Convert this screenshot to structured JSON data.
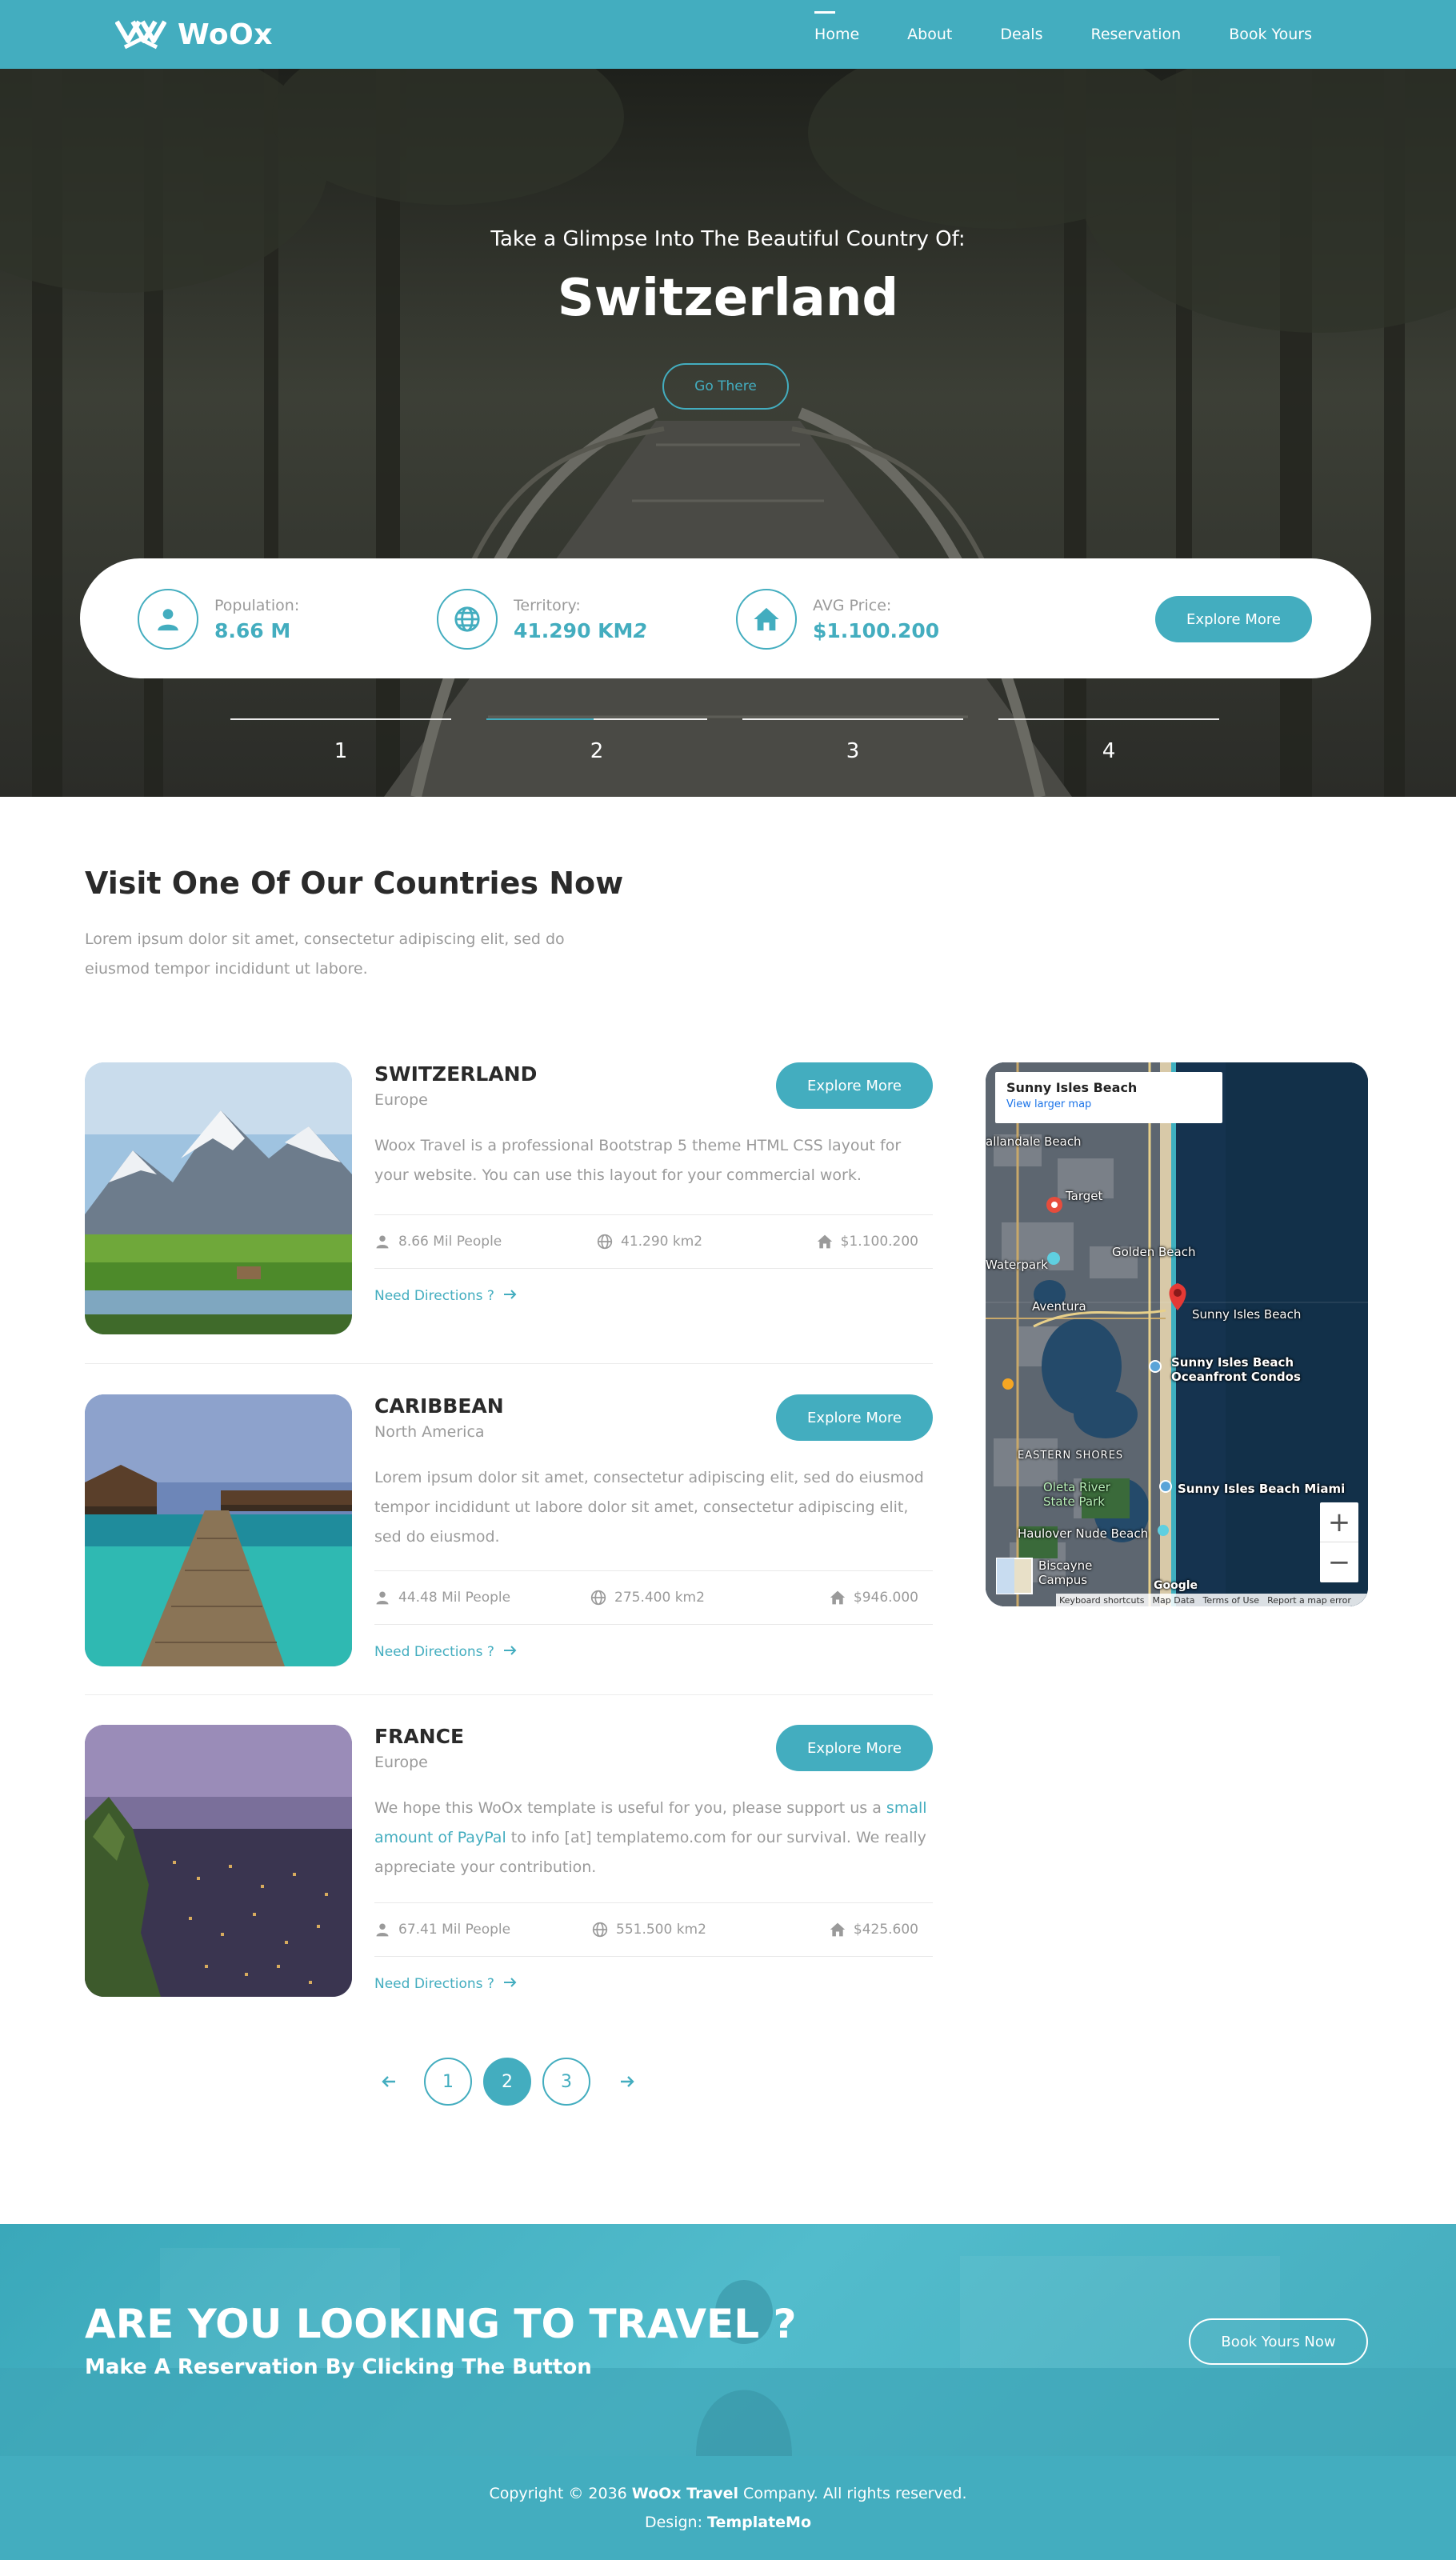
{
  "header": {
    "logo_text": "WoOx",
    "nav": [
      {
        "label": "Home",
        "active": true
      },
      {
        "label": "About"
      },
      {
        "label": "Deals"
      },
      {
        "label": "Reservation"
      },
      {
        "label": "Book Yours"
      }
    ]
  },
  "hero": {
    "subtitle": "Take a Glimpse Into The Beautiful Country Of:",
    "title": "Switzerland",
    "button": "Go There",
    "stats": [
      {
        "label": "Population:",
        "value": "8.66 M",
        "icon": "user-icon"
      },
      {
        "label": "Territory:",
        "value": "41.290 KM",
        "value_sup": "2",
        "icon": "globe-icon"
      },
      {
        "label": "AVG Price:",
        "value": "$1.100.200",
        "icon": "home-icon"
      }
    ],
    "stats_button": "Explore More",
    "slides": [
      "1",
      "2",
      "3",
      "4"
    ],
    "active_slide": 2
  },
  "countries": {
    "title": "Visit One Of Our Countries Now",
    "description": "Lorem ipsum dolor sit amet, consectetur adipiscing elit, sed do eiusmod tempor incididunt ut labore.",
    "items": [
      {
        "name": "SWITZERLAND",
        "region": "Europe",
        "button": "Explore More",
        "desc": "Woox Travel is a professional Bootstrap 5 theme HTML CSS layout for your website. You can use this layout for your commercial work.",
        "people": "8.66 Mil People",
        "area": "41.290 km2",
        "price": "$1.100.200",
        "directions": "Need Directions ?"
      },
      {
        "name": "CARIBBEAN",
        "region": "North America",
        "button": "Explore More",
        "desc": "Lorem ipsum dolor sit amet, consectetur adipiscing elit, sed do eiusmod tempor incididunt ut labore dolor sit amet, consectetur adipiscing elit, sed do eiusmod.",
        "people": "44.48 Mil People",
        "area": "275.400 km2",
        "price": "$946.000",
        "directions": "Need Directions ?"
      },
      {
        "name": "FRANCE",
        "region": "Europe",
        "button": "Explore More",
        "desc_before": "We hope this WoOx template is useful for you, please support us a ",
        "desc_link": "small amount of PayPal",
        "desc_after": " to info [at] templatemo.com for our survival. We really appreciate your contribution.",
        "people": "67.41 Mil People",
        "area": "551.500 km2",
        "price": "$425.600",
        "directions": "Need Directions ?"
      }
    ]
  },
  "map": {
    "card_title": "Sunny Isles Beach",
    "card_link": "View larger map",
    "labels": {
      "hallandale": "allandale Beach",
      "target": "Target",
      "golden_beach": "Golden Beach",
      "waterpark": "Waterpark",
      "aventura": "Aventura",
      "sunny_isles": "Sunny Isles Beach",
      "condos": "Sunny Isles Beach Oceanfront Condos",
      "eastern_shores": "EASTERN SHORES",
      "oleta": "Oleta River State Park",
      "miami": "Sunny Isles Beach Miami",
      "haulover": "Haulover Nude Beach",
      "biscayne": "Biscayne Campus",
      "google": "Google"
    },
    "footer": [
      "Keyboard shortcuts",
      "Map Data",
      "Terms of Use",
      "Report a map error"
    ],
    "zoom_in": "+",
    "zoom_out": "−"
  },
  "pagination": {
    "pages": [
      "1",
      "2",
      "3"
    ],
    "active": "2"
  },
  "cta": {
    "title": "ARE YOU LOOKING TO TRAVEL ?",
    "subtitle": "Make A Reservation By Clicking The Button",
    "button": "Book Yours Now"
  },
  "footer": {
    "copyright_prefix": "Copyright © 2036 ",
    "company": "WoOx Travel",
    "copyright_suffix": " Company. All rights reserved.",
    "design_prefix": "Design: ",
    "designer": "TemplateMo"
  },
  "colors": {
    "accent": "#43adbf",
    "text_dark": "#2a2a2a",
    "text_muted": "#9a9a9a"
  }
}
